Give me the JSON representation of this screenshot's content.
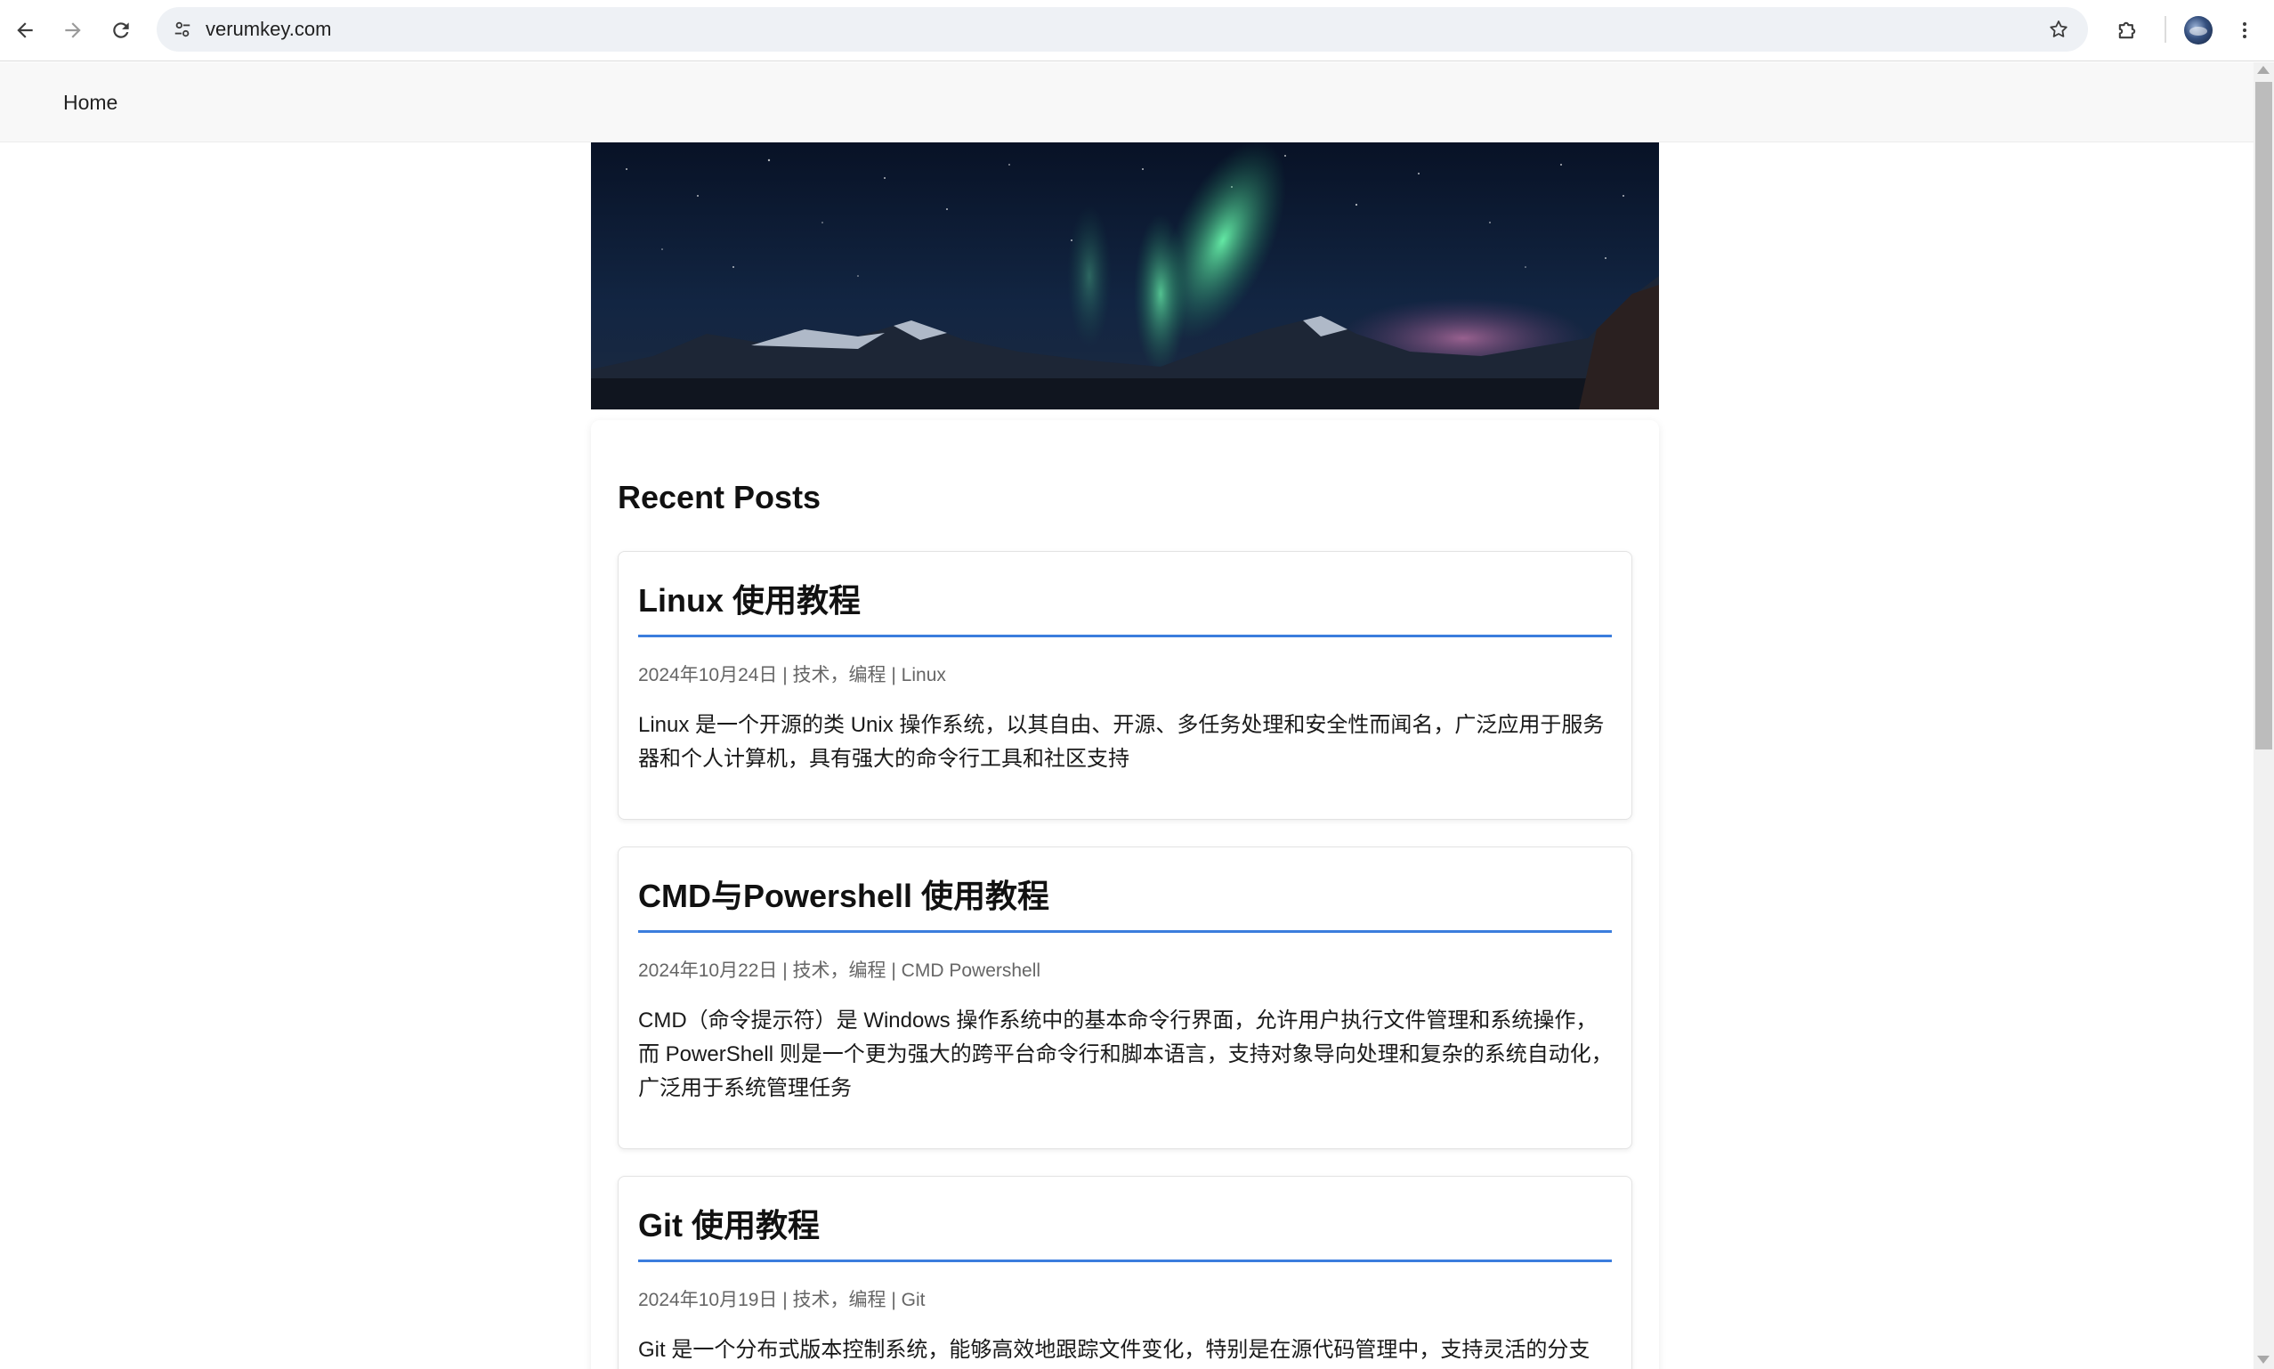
{
  "browser": {
    "url": "verumkey.com"
  },
  "site_nav": {
    "home_label": "Home"
  },
  "main": {
    "section_title": "Recent Posts",
    "posts": [
      {
        "title": "Linux 使用教程",
        "meta": "2024年10月24日 | 技术，编程 | Linux",
        "excerpt": "Linux 是一个开源的类 Unix 操作系统，以其自由、开源、多任务处理和安全性而闻名，广泛应用于服务器和个人计算机，具有强大的命令行工具和社区支持"
      },
      {
        "title": "CMD与Powershell 使用教程",
        "meta": "2024年10月22日 | 技术，编程 | CMD Powershell",
        "excerpt": "CMD（命令提示符）是 Windows 操作系统中的基本命令行界面，允许用户执行文件管理和系统操作，而 PowerShell 则是一个更为强大的跨平台命令行和脚本语言，支持对象导向处理和复杂的系统自动化，广泛用于系统管理任务"
      },
      {
        "title": "Git 使用教程",
        "meta": "2024年10月19日 | 技术，编程 | Git",
        "excerpt": "Git 是一个分布式版本控制系统，能够高效地跟踪文件变化，特别是在源代码管理中，支持灵活的分支"
      }
    ]
  },
  "colors": {
    "accent_rule": "#3b7ddd",
    "nav_background": "#f8f8f8",
    "omnibox_background": "#eef1f5"
  },
  "icons": {
    "back": "arrow-left-icon",
    "forward": "arrow-right-icon",
    "reload": "reload-icon",
    "site_info": "tune-icon",
    "bookmark": "star-icon",
    "extensions": "puzzle-icon",
    "menu": "kebab-menu-icon"
  }
}
